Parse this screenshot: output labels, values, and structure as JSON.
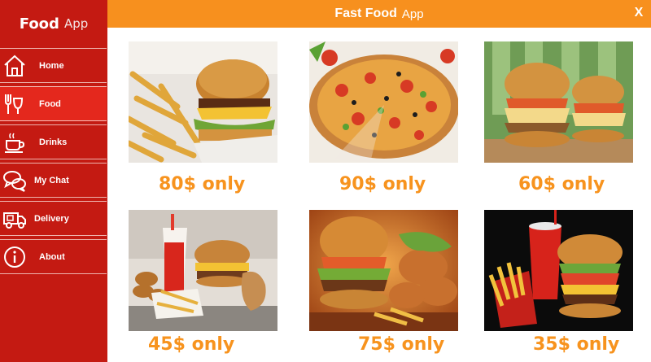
{
  "sidebar": {
    "brand_main": "Food",
    "brand_sub": "App",
    "items": [
      {
        "label": "Home",
        "icon": "home-icon"
      },
      {
        "label": "Food",
        "icon": "food-icon",
        "active": true
      },
      {
        "label": "Drinks",
        "icon": "cup-icon"
      },
      {
        "label": "My Chat",
        "icon": "chat-icon"
      },
      {
        "label": "Delivery",
        "icon": "delivery-truck-icon"
      },
      {
        "label": "About",
        "icon": "info-icon"
      }
    ]
  },
  "header": {
    "title_main": "Fast Food",
    "title_sub": "App",
    "close_label": "X"
  },
  "menu": {
    "items": [
      {
        "price": "80$ only"
      },
      {
        "price": "90$ only"
      },
      {
        "price": "60$ only"
      },
      {
        "price": "45$ only"
      },
      {
        "price": "75$ only"
      },
      {
        "price": "35$ only"
      }
    ]
  },
  "colors": {
    "sidebar": "#c41a12",
    "sidebar_active": "#e4281d",
    "topbar": "#f7901e",
    "price": "#f7931e"
  }
}
